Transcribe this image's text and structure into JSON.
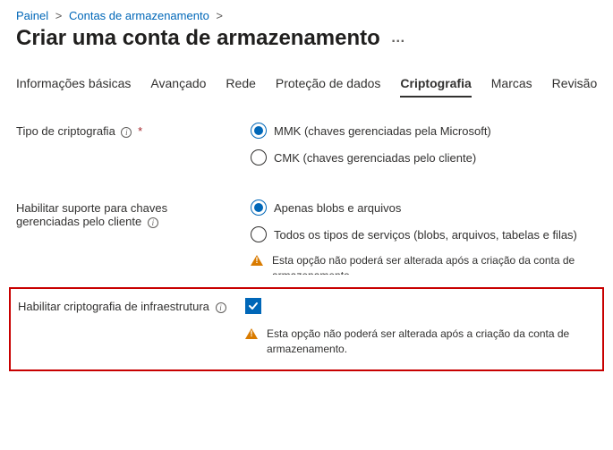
{
  "breadcrumb": {
    "item1": "Painel",
    "item2": "Contas de armazenamento"
  },
  "page": {
    "title": "Criar uma conta de armazenamento"
  },
  "tabs": {
    "t0": "Informações básicas",
    "t1": "Avançado",
    "t2": "Rede",
    "t3": "Proteção de dados",
    "t4": "Criptografia",
    "t5": "Marcas",
    "t6": "Revisão"
  },
  "fields": {
    "encryptionTypeLabel": "Tipo de criptografia",
    "mmk": "MMK (chaves gerenciadas pela Microsoft)",
    "cmk": "CMK (chaves gerenciadas pelo cliente)",
    "cmkSupportLabelLine1": "Habilitar suporte para chaves",
    "cmkSupportLabelLine2": "gerenciadas pelo cliente",
    "blobsOnly": "Apenas blobs e arquivos",
    "allServices": "Todos os tipos de serviços (blobs, arquivos, tabelas e filas)",
    "warnImmutable": "Esta opção não poderá ser alterada após a criação da conta de armazenamento.",
    "infraEncLabel": "Habilitar criptografia de infraestrutura"
  }
}
